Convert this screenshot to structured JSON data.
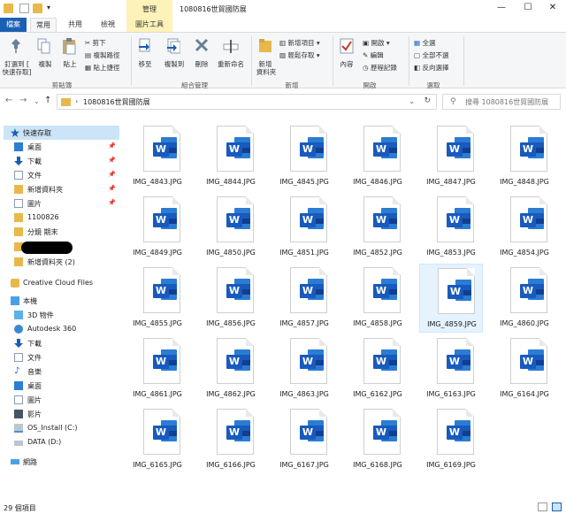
{
  "window": {
    "title": "1080816世貿國防展",
    "context_tab_group": "管理",
    "controls": {
      "minimize": "—",
      "maximize": "☐",
      "close": "✕"
    }
  },
  "qat": {
    "dropdown": "▾"
  },
  "tabs": {
    "file": "檔案",
    "home": "常用",
    "share": "共用",
    "view": "檢視",
    "picture_tools": "圖片工具"
  },
  "ribbon": {
    "clipboard": {
      "pin_line1": "釘選到 [",
      "pin_line2": "快速存取]",
      "copy": "複製",
      "paste": "貼上",
      "cut": "剪下",
      "copy_path": "複製路徑",
      "paste_shortcut": "貼上捷徑",
      "label": "剪貼簿"
    },
    "organize": {
      "move_to": "移至",
      "copy_to": "複製到",
      "delete": "刪除",
      "rename": "重新命名",
      "label": "組合管理"
    },
    "new": {
      "new_folder_line1": "新增",
      "new_folder_line2": "資料夾",
      "new_item": "新增項目 ▾",
      "easy_access": "輕鬆存取 ▾",
      "label": "新增"
    },
    "open": {
      "properties": "內容",
      "open": "開啟 ▾",
      "edit": "編輯",
      "history": "歷程記錄",
      "label": "開啟"
    },
    "select": {
      "select_all": "全選",
      "select_none": "全部不選",
      "invert": "反向選擇",
      "label": "選取"
    }
  },
  "address": {
    "back": "←",
    "forward": "→",
    "recent": "⌄",
    "up": "↑",
    "separator": "›",
    "path": "1080816世貿國防展",
    "dropdown": "⌄",
    "refresh": "↻",
    "search_icon": "⚲",
    "search_placeholder": "搜尋 1080816世貿國防展"
  },
  "nav": {
    "pin": "📌",
    "quick_access": "快速存取",
    "desktop": "桌面",
    "downloads": "下載",
    "documents": "文件",
    "new_folder": "新增資料夾",
    "pictures": "圖片",
    "folder_1100826": "1100826",
    "folder_class": "分鏡 期末",
    "new_folder_2": "新增資料夾 (2)",
    "creative_cloud": "Creative Cloud Files",
    "this_pc": "本機",
    "objects3d": "3D 物件",
    "autodesk": "Autodesk 360",
    "pc_downloads": "下載",
    "pc_documents": "文件",
    "music": "音樂",
    "pc_desktop": "桌面",
    "pc_pictures": "圖片",
    "videos": "影片",
    "os_drive": "OS_Install (C:)",
    "data_drive": "DATA (D:)",
    "network": "網路"
  },
  "files": [
    "IMG_4843.JPG",
    "IMG_4844.JPG",
    "IMG_4845.JPG",
    "IMG_4846.JPG",
    "IMG_4847.JPG",
    "IMG_4848.JPG",
    "IMG_4849.JPG",
    "IMG_4850.JPG",
    "IMG_4851.JPG",
    "IMG_4852.JPG",
    "IMG_4853.JPG",
    "IMG_4854.JPG",
    "IMG_4855.JPG",
    "IMG_4856.JPG",
    "IMG_4857.JPG",
    "IMG_4858.JPG",
    "IMG_4859.JPG",
    "IMG_4860.JPG",
    "IMG_4861.JPG",
    "IMG_4862.JPG",
    "IMG_4863.JPG",
    "IMG_6162.JPG",
    "IMG_6163.JPG",
    "IMG_6164.JPG",
    "IMG_6165.JPG",
    "IMG_6166.JPG",
    "IMG_6167.JPG",
    "IMG_6168.JPG",
    "IMG_6169.JPG"
  ],
  "file_icon_letter": "W",
  "selected_file": "IMG_4859.JPG",
  "status": {
    "item_count": "29 個項目"
  },
  "colors": {
    "accent": "#1a5fb4",
    "word_blue": "#185abd",
    "folder": "#e8b84a",
    "context_tab": "#fdf2b8"
  }
}
